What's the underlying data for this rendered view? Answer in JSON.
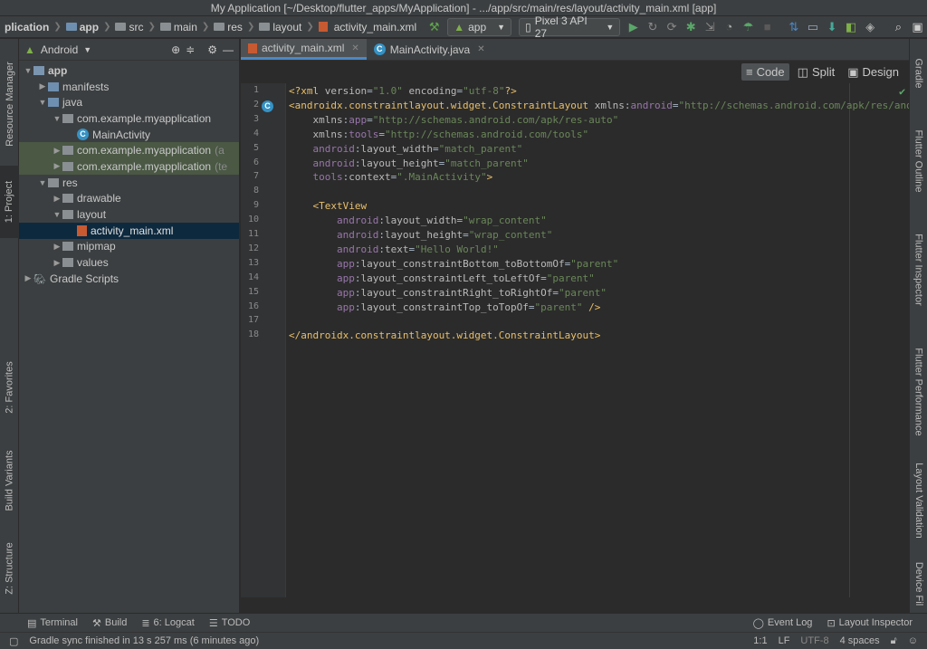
{
  "window": {
    "title": "My Application [~/Desktop/flutter_apps/MyApplication] - .../app/src/main/res/layout/activity_main.xml [app]"
  },
  "breadcrumb": [
    "plication",
    "app",
    "src",
    "main",
    "res",
    "layout",
    "activity_main.xml"
  ],
  "toolbar": {
    "run_config": "app",
    "device": "Pixel 3 API 27"
  },
  "left_tools": {
    "resource_manager": "Resource Manager",
    "project": "1: Project",
    "favorites": "2: Favorites",
    "build_variants": "Build Variants",
    "structure": "Z: Structure"
  },
  "right_tools": {
    "gradle": "Gradle",
    "flutter_outline": "Flutter Outline",
    "flutter_inspector": "Flutter Inspector",
    "flutter_performance": "Flutter Performance",
    "layout_validation": "Layout Validation",
    "device_file": "Device Fil"
  },
  "project": {
    "view_label": "Android",
    "tree": [
      {
        "label": "app",
        "indent": 0
      },
      {
        "label": "manifests",
        "indent": 1
      },
      {
        "label": "java",
        "indent": 1
      },
      {
        "label": "com.example.myapplication",
        "indent": 2
      },
      {
        "label": "MainActivity",
        "indent": 3
      },
      {
        "label": "com.example.myapplication",
        "suffix": "(a",
        "indent": 2
      },
      {
        "label": "com.example.myapplication",
        "suffix": "(te",
        "indent": 2
      },
      {
        "label": "res",
        "indent": 1
      },
      {
        "label": "drawable",
        "indent": 2
      },
      {
        "label": "layout",
        "indent": 2
      },
      {
        "label": "activity_main.xml",
        "indent": 3
      },
      {
        "label": "mipmap",
        "indent": 2
      },
      {
        "label": "values",
        "indent": 2
      },
      {
        "label": "Gradle Scripts",
        "indent": 0
      }
    ]
  },
  "editor": {
    "tabs": [
      {
        "label": "activity_main.xml"
      },
      {
        "label": "MainActivity.java"
      }
    ],
    "modes": {
      "code": "Code",
      "split": "Split",
      "design": "Design"
    },
    "line_numbers": [
      "1",
      "2",
      "3",
      "4",
      "5",
      "6",
      "7",
      "8",
      "9",
      "10",
      "11",
      "12",
      "13",
      "14",
      "15",
      "16",
      "17",
      "18"
    ],
    "lines": [
      "<?xml version=\"1.0\" encoding=\"utf-8\"?>",
      "<androidx.constraintlayout.widget.ConstraintLayout xmlns:android=\"http://schemas.android.com/apk/res/android\"",
      "    xmlns:app=\"http://schemas.android.com/apk/res-auto\"",
      "    xmlns:tools=\"http://schemas.android.com/tools\"",
      "    android:layout_width=\"match_parent\"",
      "    android:layout_height=\"match_parent\"",
      "    tools:context=\".MainActivity\">",
      "",
      "    <TextView",
      "        android:layout_width=\"wrap_content\"",
      "        android:layout_height=\"wrap_content\"",
      "        android:text=\"Hello World!\"",
      "        app:layout_constraintBottom_toBottomOf=\"parent\"",
      "        app:layout_constraintLeft_toLeftOf=\"parent\"",
      "        app:layout_constraintRight_toRightOf=\"parent\"",
      "        app:layout_constraintTop_toTopOf=\"parent\" />",
      "",
      "</androidx.constraintlayout.widget.ConstraintLayout>"
    ]
  },
  "bottom_tools": {
    "terminal": "Terminal",
    "build": "Build",
    "logcat": "6: Logcat",
    "todo": "TODO",
    "event_log": "Event Log",
    "layout_inspector": "Layout Inspector"
  },
  "status": {
    "message": "Gradle sync finished in 13 s 257 ms (6 minutes ago)",
    "position": "1:1",
    "line_sep": "LF",
    "encoding": "UTF-8",
    "indent": "4 spaces"
  }
}
